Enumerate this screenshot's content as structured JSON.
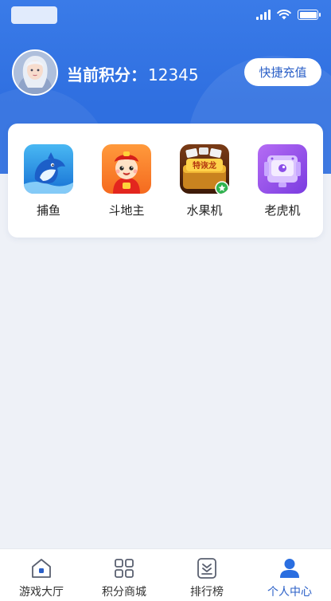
{
  "header": {
    "points_label": "当前积分：",
    "points_value": "12345",
    "recharge_button": "快捷充值"
  },
  "games": [
    {
      "label": "捕鱼",
      "icon": "dolphin-icon"
    },
    {
      "label": "斗地主",
      "icon": "fortune-boy-icon"
    },
    {
      "label": "水果机",
      "icon": "treasure-chest-icon",
      "badge_text": "特诙龙"
    },
    {
      "label": "老虎机",
      "icon": "slot-machine-icon"
    }
  ],
  "nav": [
    {
      "label": "游戏大厅",
      "icon": "home-icon",
      "active": false
    },
    {
      "label": "积分商城",
      "icon": "grid-icon",
      "active": false
    },
    {
      "label": "排行榜",
      "icon": "rank-icon",
      "active": false
    },
    {
      "label": "个人中心",
      "icon": "user-icon",
      "active": true
    }
  ],
  "colors": {
    "primary": "#2f6fe0",
    "accent_text": "#2a5fc7",
    "page_bg": "#eef1f7"
  }
}
